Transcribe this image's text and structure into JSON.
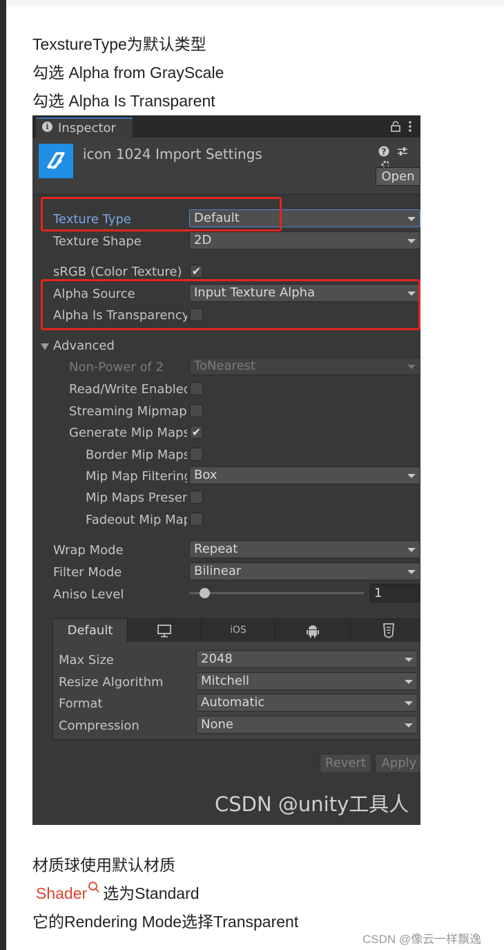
{
  "article": {
    "line1": "TexstureType为默认类型",
    "line2": "勾选 Alpha from GrayScale",
    "line3": "勾选 Alpha Is Transparent",
    "line4": "材质球使用默认材质",
    "line5_link": "Shader",
    "line5_rest": "选为Standard",
    "line6": "它的Rendering Mode选择Transparent",
    "footer": "CSDN @像云一样飘逸"
  },
  "inspector": {
    "tab_label": "Inspector",
    "title": "icon 1024 Import Settings",
    "open_button": "Open",
    "texture_type_label": "Texture Type",
    "texture_type_value": "Default",
    "texture_shape_label": "Texture Shape",
    "texture_shape_value": "2D",
    "srgb_label": "sRGB (Color Texture)",
    "srgb_checked": "✔",
    "alpha_source_label": "Alpha Source",
    "alpha_source_value": "Input Texture Alpha",
    "alpha_transparency_label": "Alpha Is Transparency",
    "advanced_label": "Advanced",
    "npot_label": "Non-Power of 2",
    "npot_value": "ToNearest",
    "readwrite_label": "Read/Write Enabled",
    "streaming_label": "Streaming Mipmaps",
    "genmip_label": "Generate Mip Maps",
    "genmip_checked": "✔",
    "bordermip_label": "Border Mip Maps",
    "mipfilter_label": "Mip Map Filtering",
    "mipfilter_value": "Box",
    "mippreserve_label": "Mip Maps Preserve Coverage",
    "fadeout_label": "Fadeout Mip Maps",
    "wrap_label": "Wrap Mode",
    "wrap_value": "Repeat",
    "filter_label": "Filter Mode",
    "filter_value": "Bilinear",
    "aniso_label": "Aniso Level",
    "aniso_value": "1",
    "platform_tabs": {
      "default": "Default",
      "ios": "iOS"
    },
    "max_size_label": "Max Size",
    "max_size_value": "2048",
    "resize_label": "Resize Algorithm",
    "resize_value": "Mitchell",
    "format_label": "Format",
    "format_value": "Automatic",
    "compression_label": "Compression",
    "compression_value": "None",
    "revert_button": "Revert",
    "apply_button": "Apply",
    "watermark": "CSDN @unity工具人"
  },
  "colors": {
    "highlight_box": "#e2261c",
    "link": "#e3402f",
    "focus_blue": "#4b87d6"
  }
}
